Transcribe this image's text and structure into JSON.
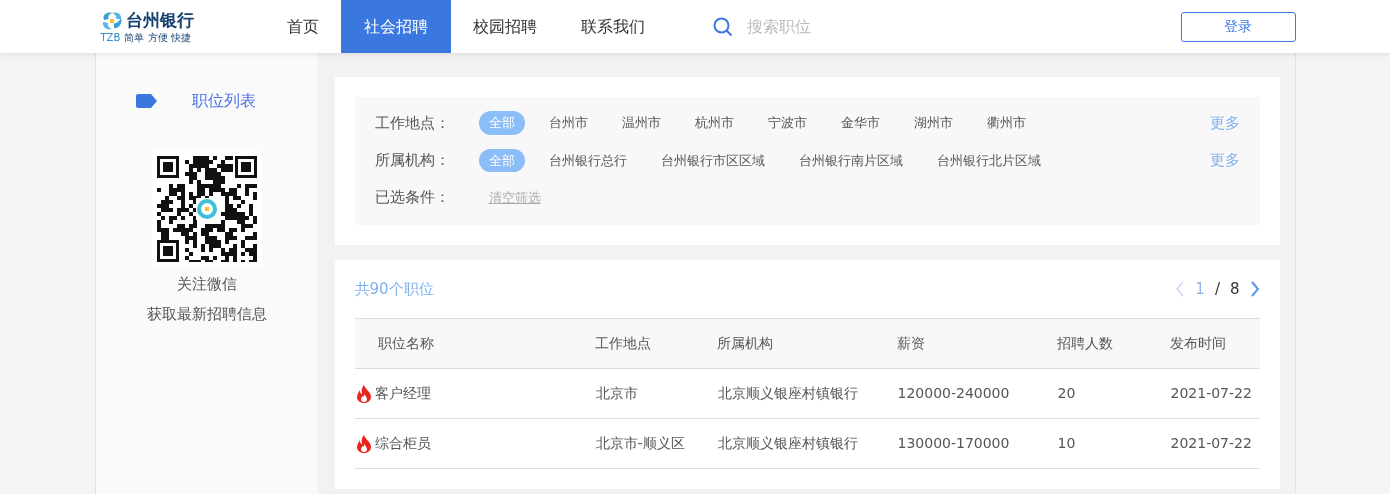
{
  "header": {
    "logo": {
      "name": "台州银行",
      "abbr": "TZB",
      "tagline": "简单 方便 快捷"
    },
    "nav": [
      {
        "label": "首页",
        "selected": false
      },
      {
        "label": "社会招聘",
        "selected": true
      },
      {
        "label": "校园招聘",
        "selected": false
      },
      {
        "label": "联系我们",
        "selected": false
      }
    ],
    "search": {
      "placeholder": "搜索职位"
    },
    "login_button": "登录"
  },
  "sidebar": {
    "menu_item": "职位列表",
    "qr_caption": [
      "关注微信",
      "获取最新招聘信息"
    ]
  },
  "filters": {
    "rows": [
      {
        "label": "工作地点：",
        "options": [
          {
            "label": "全部",
            "selected": true
          },
          {
            "label": "台州市",
            "selected": false
          },
          {
            "label": "温州市",
            "selected": false
          },
          {
            "label": "杭州市",
            "selected": false
          },
          {
            "label": "宁波市",
            "selected": false
          },
          {
            "label": "金华市",
            "selected": false
          },
          {
            "label": "湖州市",
            "selected": false
          },
          {
            "label": "衢州市",
            "selected": false
          }
        ],
        "more": "更多"
      },
      {
        "label": "所属机构：",
        "options": [
          {
            "label": "全部",
            "selected": true
          },
          {
            "label": "台州银行总行",
            "selected": false
          },
          {
            "label": "台州银行市区区域",
            "selected": false
          },
          {
            "label": "台州银行南片区域",
            "selected": false
          },
          {
            "label": "台州银行北片区域",
            "selected": false
          }
        ],
        "more": "更多"
      }
    ],
    "selected_conditions": {
      "label": "已选条件：",
      "clear_link": "清空筛选"
    }
  },
  "results": {
    "count": "共90个职位",
    "pagination": {
      "current": "1",
      "separator": "/",
      "total": "8"
    },
    "table": {
      "columns": [
        "职位名称",
        "工作地点",
        "所属机构",
        "薪资",
        "招聘人数",
        "发布时间"
      ],
      "rows": [
        {
          "hot": true,
          "cells": [
            "客户经理",
            "北京市",
            "北京顺义银座村镇银行",
            "120000-240000",
            "20",
            "2021-07-22"
          ]
        },
        {
          "hot": true,
          "cells": [
            "综合柜员",
            "北京市-顺义区",
            "北京顺义银座村镇银行",
            "130000-170000",
            "10",
            "2021-07-22"
          ]
        }
      ]
    }
  }
}
